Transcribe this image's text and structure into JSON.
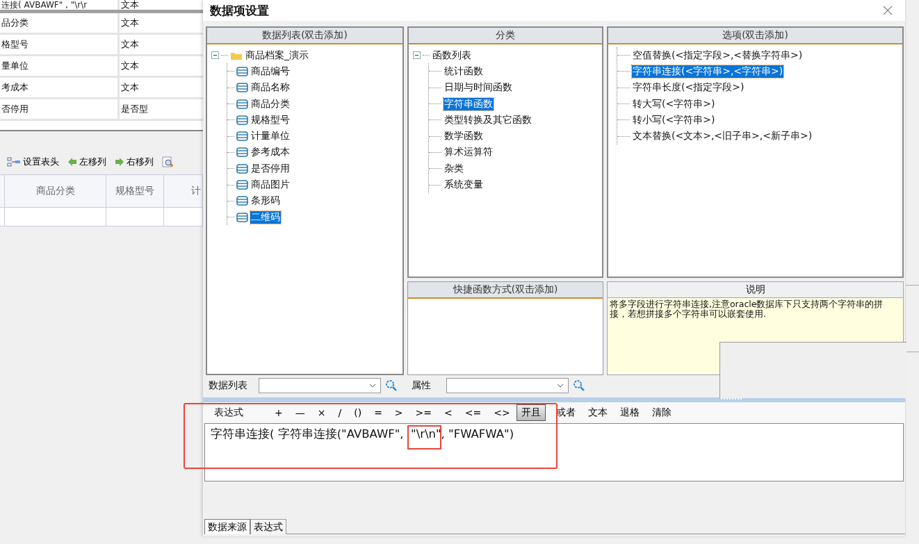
{
  "background_app": {
    "field_table": {
      "rows": [
        {
          "name": "连接( AVBAWF\" , \"\\r\\r",
          "type": "文本"
        },
        {
          "name": "品分类",
          "type": "文本"
        },
        {
          "name": "格型号",
          "type": "文本"
        },
        {
          "name": "量单位",
          "type": "文本"
        },
        {
          "name": "考成本",
          "type": "文本"
        },
        {
          "name": "否停用",
          "type": "是否型"
        }
      ]
    },
    "toolbar": [
      {
        "label": "设置表头",
        "kind": "header"
      },
      {
        "label": "左移列",
        "kind": "left"
      },
      {
        "label": "右移列",
        "kind": "right"
      },
      {
        "kind": "preview"
      }
    ],
    "grid": {
      "columns": [
        "商品分类",
        "规格型号",
        "计"
      ]
    }
  },
  "dialog": {
    "title": "数据项设置",
    "data_list": {
      "title": "数据列表(双击添加)",
      "tree": [
        {
          "label": "商品档案_演示",
          "expanded": true,
          "children": [
            {
              "label": "商品编号",
              "selected": false
            },
            {
              "label": "商品名称",
              "selected": false
            },
            {
              "label": "商品分类",
              "selected": false
            },
            {
              "label": "规格型号",
              "selected": false
            },
            {
              "label": "计量单位",
              "selected": false
            },
            {
              "label": "参考成本",
              "selected": false
            },
            {
              "label": "是否停用",
              "selected": false
            },
            {
              "label": "商品图片",
              "selected": false
            },
            {
              "label": "条形码",
              "selected": false
            },
            {
              "label": "二维码",
              "selected": true
            }
          ]
        }
      ]
    },
    "category": {
      "title": "分类",
      "tree": [
        {
          "label": "函数列表",
          "expanded": true,
          "children": [
            {
              "label": "统计函数",
              "selected": false
            },
            {
              "label": "日期与时间函数",
              "selected": false
            },
            {
              "label": "字符串函数",
              "selected": true
            },
            {
              "label": "类型转换及其它函数",
              "selected": false
            },
            {
              "label": "数学函数",
              "selected": false
            },
            {
              "label": "算术运算符",
              "selected": false
            },
            {
              "label": "杂类",
              "selected": false
            },
            {
              "label": "系统变量",
              "selected": false
            }
          ]
        }
      ]
    },
    "options": {
      "title": "选项(双击添加)",
      "items": [
        {
          "label": "空值替换(<指定字段>,<替换字符串>)",
          "selected": false
        },
        {
          "label": "字符串连接(<字符串>,<字符串>)",
          "selected": true
        },
        {
          "label": "字符串长度(<指定字段>)",
          "selected": false
        },
        {
          "label": "转大写(<字符串>)",
          "selected": false
        },
        {
          "label": "转小写(<字符串>)",
          "selected": false
        },
        {
          "label": "文本替换(<文本>,<旧子串>,<新子串>)",
          "selected": false
        }
      ]
    },
    "shortcuts": {
      "title": "快捷函数方式(双击添加)"
    },
    "description": {
      "title": "说明",
      "text": "将多字段进行字符串连接,注意oracle数据库下只支持两个字符串的拼接，若想拼接多个字符串可以嵌套使用."
    },
    "filters": [
      {
        "label": "数据列表"
      },
      {
        "label": "属性"
      }
    ],
    "expression_toolbar": {
      "label": "表达式",
      "buttons": [
        {
          "label": "+",
          "selected": false
        },
        {
          "label": "—",
          "selected": false
        },
        {
          "label": "×",
          "selected": false
        },
        {
          "label": "/",
          "selected": false
        },
        {
          "label": "()",
          "selected": false
        },
        {
          "label": "=",
          "selected": false
        },
        {
          "label": ">",
          "selected": false
        },
        {
          "label": ">=",
          "selected": false
        },
        {
          "label": "<",
          "selected": false
        },
        {
          "label": "<=",
          "selected": false
        },
        {
          "label": "<>",
          "selected": false
        },
        {
          "label": "开且",
          "selected": true
        },
        {
          "label": "或者",
          "selected": false
        },
        {
          "label": "文本",
          "selected": false
        },
        {
          "label": "退格",
          "selected": false
        },
        {
          "label": "清除",
          "selected": false
        }
      ]
    },
    "expression": "字符串连接( 字符串连接(\"AVBAWF\",  \"\\r\\n\", \"FWAFWA\")",
    "tabs": [
      {
        "label": "数据来源",
        "selected": true
      },
      {
        "label": "表达式",
        "selected": false
      }
    ]
  }
}
